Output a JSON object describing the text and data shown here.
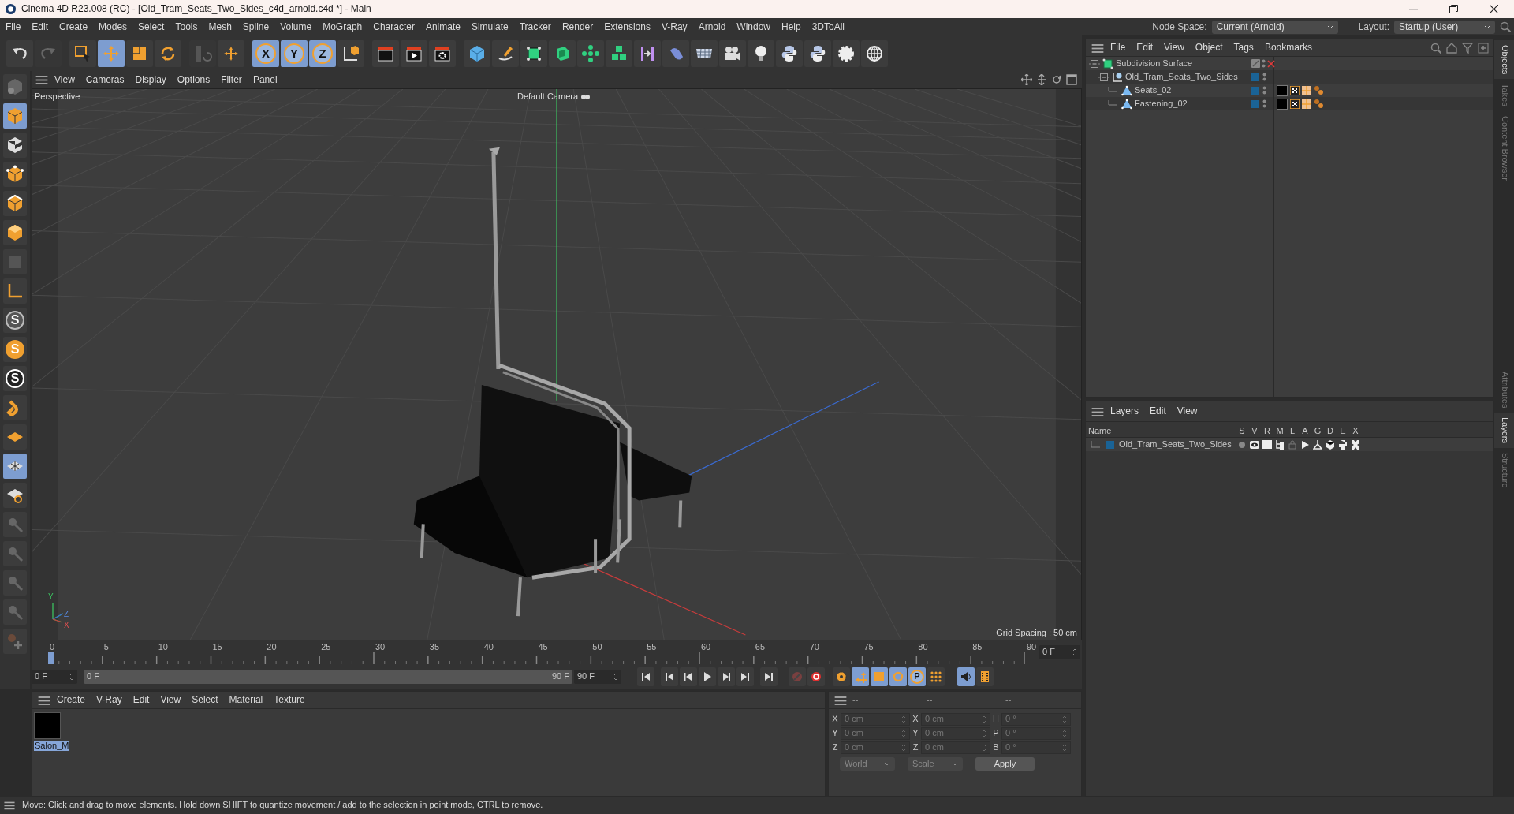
{
  "window": {
    "title": "Cinema 4D R23.008 (RC) - [Old_Tram_Seats_Two_Sides_c4d_arnold.c4d *] - Main"
  },
  "menu": [
    "File",
    "Edit",
    "Create",
    "Modes",
    "Select",
    "Tools",
    "Mesh",
    "Spline",
    "Volume",
    "MoGraph",
    "Character",
    "Animate",
    "Simulate",
    "Tracker",
    "Render",
    "Extensions",
    "V-Ray",
    "Arnold",
    "Window",
    "Help",
    "3DToAll"
  ],
  "node_space": {
    "label": "Node Space:",
    "value": "Current (Arnold)"
  },
  "layout": {
    "label": "Layout:",
    "value": "Startup (User)"
  },
  "toolbar": {
    "tools": [
      {
        "kind": "selection",
        "selected": false
      },
      {
        "kind": "move",
        "selected": true
      },
      {
        "kind": "scale",
        "selected": false
      },
      {
        "kind": "rotate",
        "selected": false
      }
    ],
    "axis_buttons": [
      {
        "label": "X",
        "selected": true
      },
      {
        "label": "Y",
        "selected": true
      },
      {
        "label": "Z",
        "selected": true
      }
    ]
  },
  "left_modes": [
    {
      "kind": "model",
      "selected": true
    },
    {
      "kind": "texture",
      "selected": false
    },
    {
      "kind": "points",
      "selected": false
    },
    {
      "kind": "edges",
      "selected": false
    },
    {
      "kind": "polygons",
      "selected": false
    }
  ],
  "snap_glyphs": [
    "S",
    "S",
    "S"
  ],
  "viewport": {
    "menu": [
      "View",
      "Cameras",
      "Display",
      "Options",
      "Filter",
      "Panel"
    ],
    "view_name": "Perspective",
    "camera": "Default Camera",
    "grid_spacing": "Grid Spacing : 50 cm",
    "gizmo_labels": [
      "Y",
      "Z",
      "X"
    ]
  },
  "object_manager": {
    "menu": [
      "File",
      "Edit",
      "View",
      "Object",
      "Tags",
      "Bookmarks"
    ],
    "objects": [
      {
        "name": "Subdivision Surface",
        "kind": "generator",
        "enabled": false,
        "children": [
          {
            "name": "Old_Tram_Seats_Two_Sides",
            "kind": "null",
            "color": "#1a6396",
            "children": [
              {
                "name": "Seats_02",
                "kind": "polygon",
                "color": "#1a6396",
                "material": true
              },
              {
                "name": "Fastening_02",
                "kind": "polygon",
                "color": "#1a6396",
                "material": true
              }
            ]
          }
        ]
      }
    ]
  },
  "side_tabs_top": [
    {
      "label": "Objects",
      "selected": true
    },
    {
      "label": "Takes",
      "selected": false
    },
    {
      "label": "Content Browser",
      "selected": false
    }
  ],
  "side_tabs_bottom": [
    {
      "label": "Attributes",
      "selected": false
    },
    {
      "label": "Layers",
      "selected": true
    },
    {
      "label": "Structure",
      "selected": false
    }
  ],
  "layers_manager": {
    "menu": [
      "Layers",
      "Edit",
      "View"
    ],
    "columns": [
      "Name",
      "S",
      "V",
      "R",
      "M",
      "L",
      "A",
      "G",
      "D",
      "E",
      "X"
    ],
    "layers": [
      {
        "name": "Old_Tram_Seats_Two_Sides",
        "color": "#1a6396"
      }
    ]
  },
  "timeline": {
    "ticks": [
      "0",
      "5",
      "10",
      "15",
      "20",
      "25",
      "30",
      "35",
      "40",
      "45",
      "50",
      "55",
      "60",
      "65",
      "70",
      "75",
      "80",
      "85",
      "90"
    ],
    "playhead": {
      "level": 0
    },
    "range_slider": {
      "level": 1
    },
    "current_frame": "0 F",
    "start": "0 F",
    "range_start": "0 F",
    "range_end": "90 F",
    "end": "90 F",
    "key_glyph": "P"
  },
  "material_manager": {
    "menu": [
      "Create",
      "V-Ray",
      "Edit",
      "View",
      "Select",
      "Material",
      "Texture"
    ],
    "materials": [
      {
        "name": "Salon_M",
        "selected": true
      }
    ]
  },
  "coordinates": {
    "headers": [
      "--",
      "--",
      "--"
    ],
    "rows": [
      {
        "l1": "X",
        "v1": "0 cm",
        "l2": "X",
        "v2": "0 cm",
        "l3": "H",
        "v3": "0 °"
      },
      {
        "l1": "Y",
        "v1": "0 cm",
        "l2": "Y",
        "v2": "0 cm",
        "l3": "P",
        "v3": "0 °"
      },
      {
        "l1": "Z",
        "v1": "0 cm",
        "l2": "Z",
        "v2": "0 cm",
        "l3": "B",
        "v3": "0 °"
      }
    ],
    "mode1": "World",
    "mode2": "Scale",
    "apply": "Apply"
  },
  "status_bar": "Move: Click and drag to move elements. Hold down SHIFT to quantize movement / add to the selection in point mode, CTRL to remove."
}
